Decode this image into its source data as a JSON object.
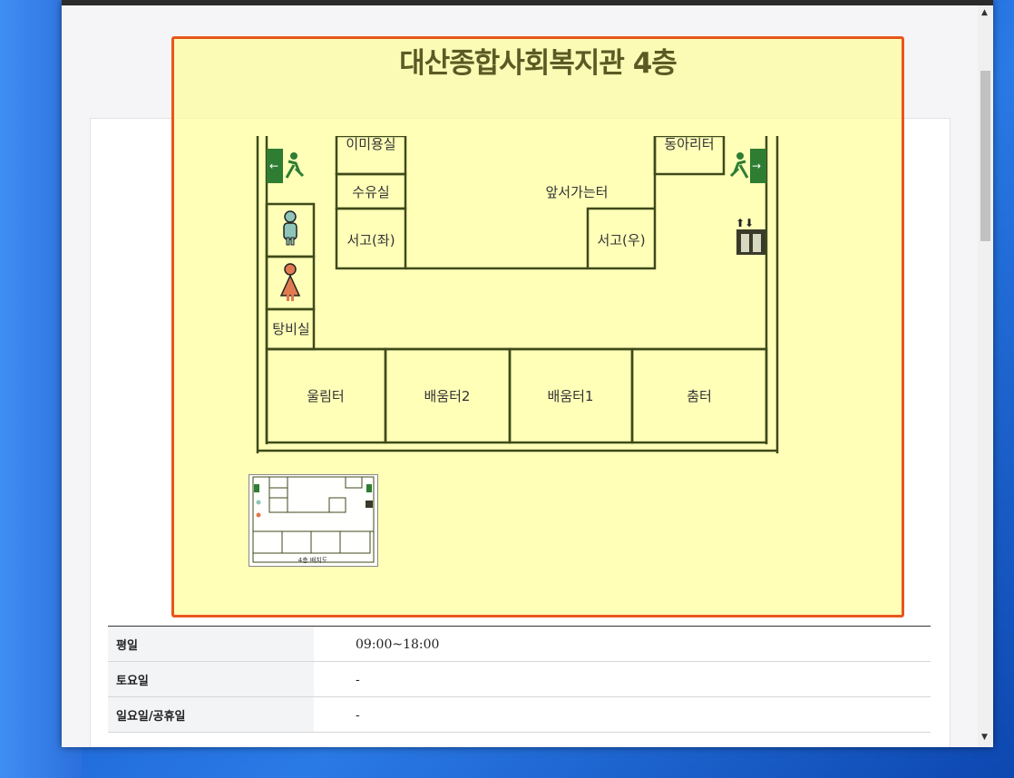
{
  "map": {
    "title": "대산종합사회복지관 4층",
    "rooms": {
      "beauty": "이미용실",
      "nursing": "수유실",
      "storage_left": "서고(좌)",
      "storage_right": "서고(우)",
      "center": "앞서가는터",
      "club": "동아리터",
      "pantry": "탕비실",
      "ullim": "울림터",
      "learn2": "배움터2",
      "learn1": "배움터1",
      "dance": "춤터"
    },
    "thumbnail_caption": "4층 배치도"
  },
  "info": {
    "rows": [
      {
        "label": "평일",
        "value": "09:00~18:00"
      },
      {
        "label": "토요일",
        "value": "-"
      },
      {
        "label": "일요일/공휴일",
        "value": "-"
      }
    ]
  },
  "colors": {
    "highlight_border": "#e8561c",
    "highlight_fill": "#ffff8c",
    "plan_line": "#3f4a1a",
    "exit_green": "#2e7d32"
  }
}
